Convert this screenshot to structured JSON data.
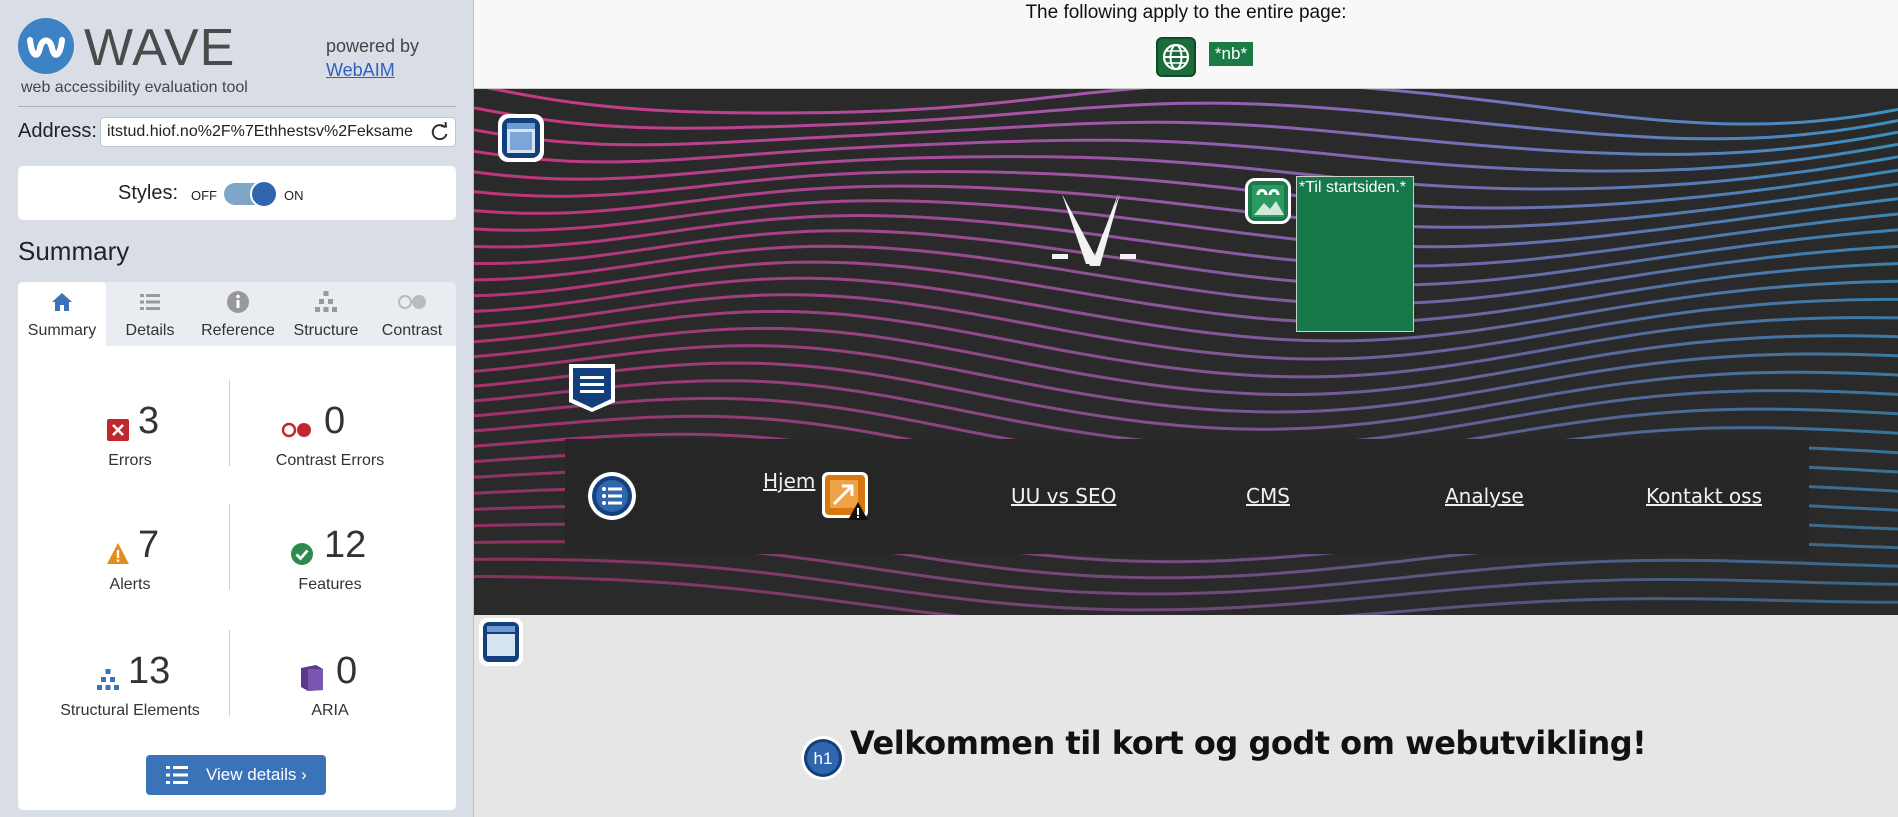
{
  "sidebar": {
    "logo_word": "WAVE",
    "logo_tagline": "web accessibility evaluation tool",
    "powered_by": "powered by",
    "webaim_link": "WebAIM",
    "address_label": "Address:",
    "address_value": "itstud.hiof.no%2F%7Ethhestsv%2Feksame",
    "styles_label": "Styles:",
    "styles_off": "OFF",
    "styles_on": "ON",
    "styles_enabled": true,
    "summary_title": "Summary",
    "tabs": [
      {
        "label": "Summary",
        "icon": "home-icon",
        "active": true
      },
      {
        "label": "Details",
        "icon": "list-icon",
        "active": false
      },
      {
        "label": "Reference",
        "icon": "info-icon",
        "active": false
      },
      {
        "label": "Structure",
        "icon": "hierarchy-icon",
        "active": false
      },
      {
        "label": "Contrast",
        "icon": "contrast-icon",
        "active": false
      }
    ],
    "stats": {
      "errors": {
        "count": "3",
        "label": "Errors",
        "color": "#c0282d"
      },
      "contrast_errors": {
        "count": "0",
        "label": "Contrast Errors",
        "color": "#c0282d"
      },
      "alerts": {
        "count": "7",
        "label": "Alerts",
        "color": "#e38c1d"
      },
      "features": {
        "count": "12",
        "label": "Features",
        "color": "#2e8a4f"
      },
      "structural": {
        "count": "13",
        "label": "Structural Elements",
        "color": "#3b73b9"
      },
      "aria": {
        "count": "0",
        "label": "ARIA",
        "color": "#5a3a8a"
      }
    },
    "view_details_label": "View details ›"
  },
  "page": {
    "notice_text": "The following apply to the entire page:",
    "lang_tag": "*nb*",
    "skip_link_text": "*Til startsiden.*",
    "nav": {
      "hjem": "Hjem",
      "uu_vs_seo": "UU vs SEO",
      "cms": "CMS",
      "analyse": "Analyse",
      "kontakt": "Kontakt oss"
    },
    "h1_badge": "h1",
    "heading": "Velkommen til kort og godt om webutvikling!"
  },
  "colors": {
    "accent_blue": "#3b73b9",
    "feature_green": "#1b7a45",
    "hero_bg": "#2a2a2a",
    "wave_pink": "#e8378f",
    "wave_blue": "#3fa3e0"
  }
}
